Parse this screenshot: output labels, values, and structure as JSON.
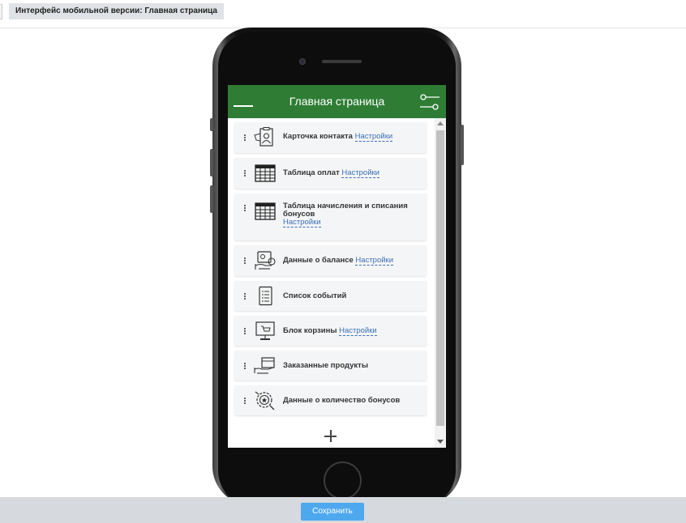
{
  "page": {
    "title": "Интерфейс мобильной версии: Главная страница"
  },
  "app": {
    "title": "Главная страница",
    "header_color": "#2f7d35",
    "menu_icon": "hamburger-icon",
    "settings_icon": "filter-sliders-icon"
  },
  "widgets": [
    {
      "label": "Карточка контакта",
      "link": "Настройки",
      "icon": "contact-card-icon"
    },
    {
      "label": "Таблица оплат",
      "link": "Настройки",
      "icon": "table-icon"
    },
    {
      "label": "Таблица начисления и списания бонусов",
      "link": "Настройки",
      "icon": "table-icon"
    },
    {
      "label": "Данные о балансе",
      "link": "Настройки",
      "icon": "balance-icon"
    },
    {
      "label": "Список событий",
      "link": "",
      "icon": "event-list-icon"
    },
    {
      "label": "Блок корзины",
      "link": "Настройки",
      "icon": "cart-monitor-icon"
    },
    {
      "label": "Заказанные продукты",
      "link": "",
      "icon": "ordered-box-icon"
    },
    {
      "label": "Данные о количество бонусов",
      "link": "",
      "icon": "bonus-badge-icon"
    }
  ],
  "footer": {
    "save_label": "Сохранить",
    "save_color": "#4ea8ee"
  }
}
